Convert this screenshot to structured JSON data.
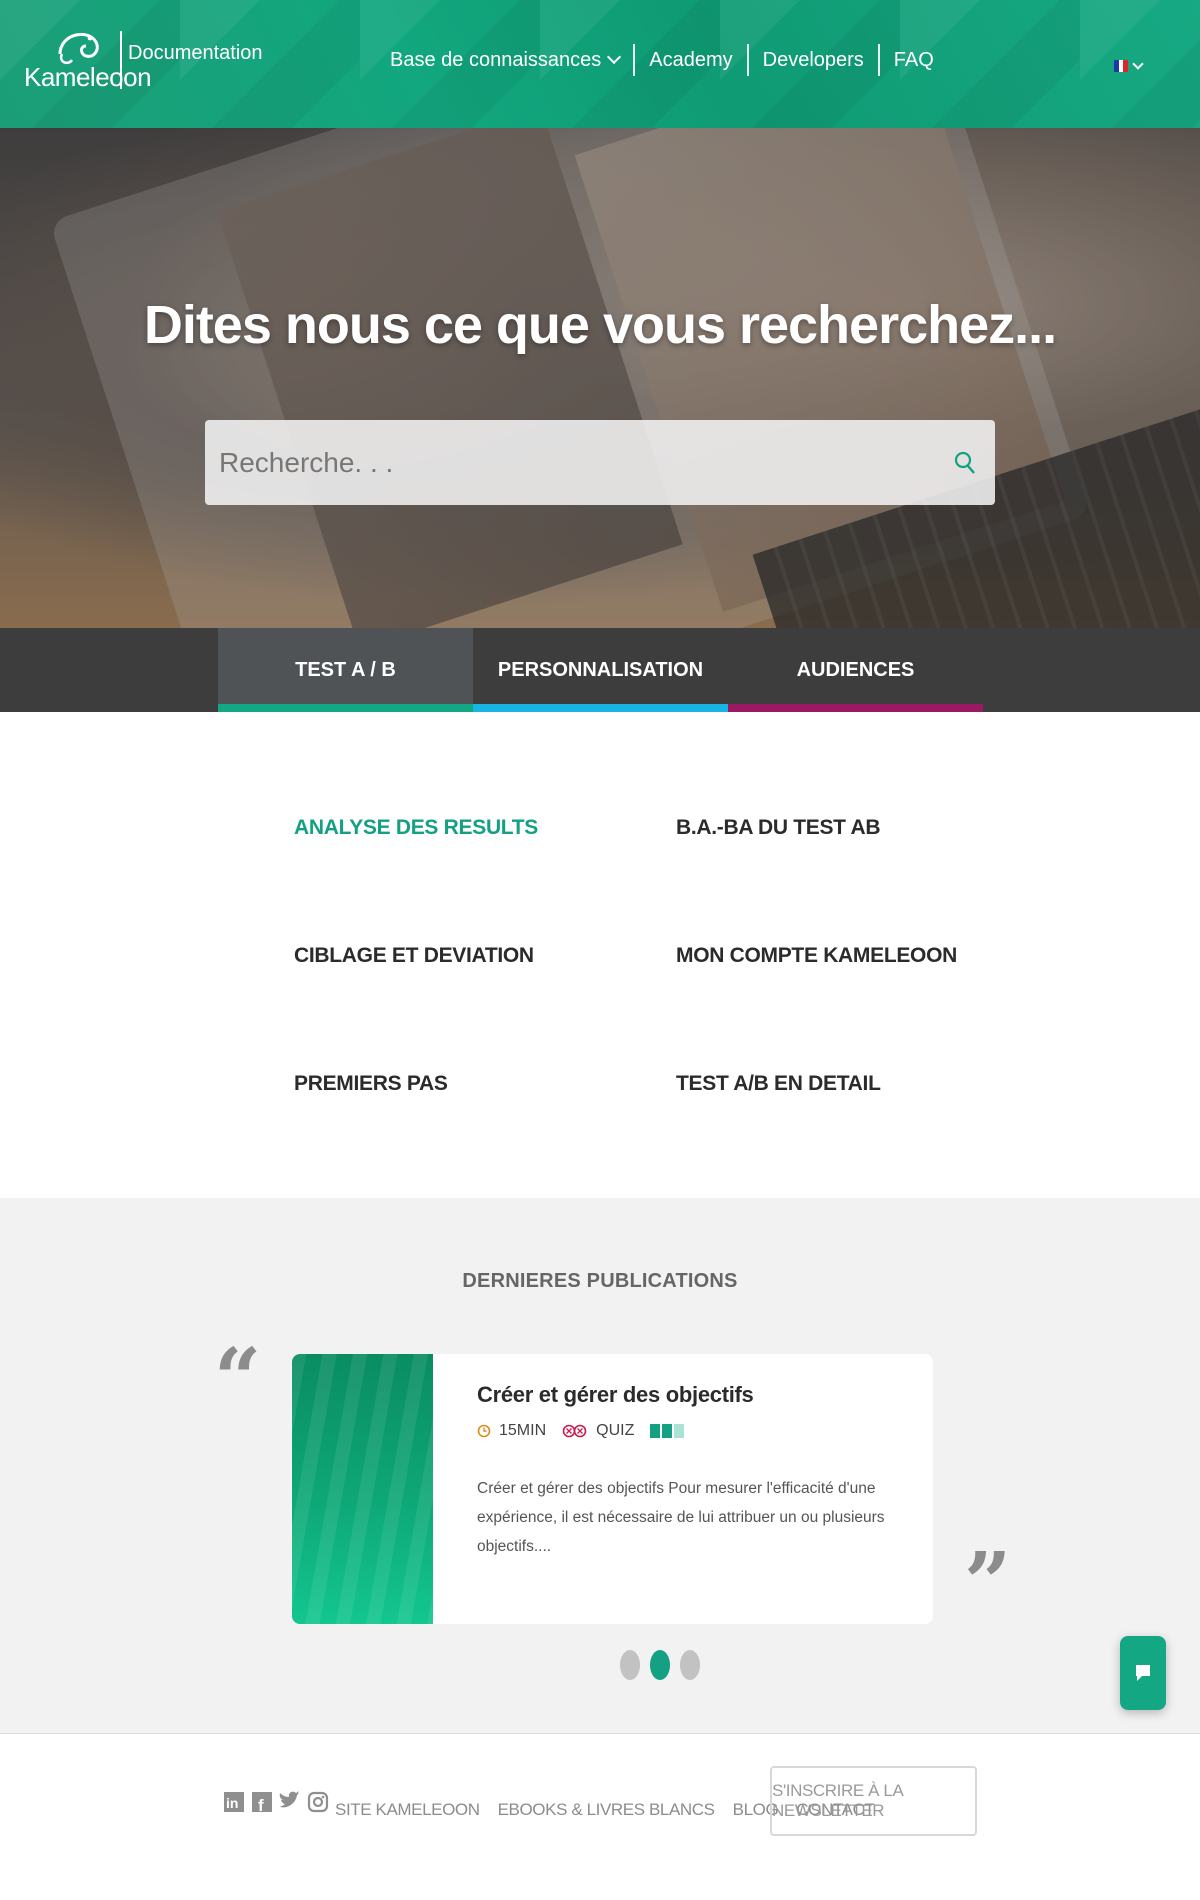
{
  "header": {
    "logo_text": "Kameleoon",
    "section_label": "Documentation",
    "nav": [
      {
        "label": "Base de connaissances"
      },
      {
        "label": "Academy"
      },
      {
        "label": "Developers"
      },
      {
        "label": "FAQ"
      }
    ],
    "language_flag": "fr-flag-icon"
  },
  "hero": {
    "title": "Dites nous ce que vous recherchez...",
    "search_placeholder": "Recherche. . ."
  },
  "tabs": [
    {
      "label": "TEST A / B",
      "underline_color": "#14a785",
      "active": true
    },
    {
      "label": "PERSONNALISATION",
      "underline_color": "#18b5e2",
      "active": false
    },
    {
      "label": "AUDIENCES",
      "underline_color": "#9b1863",
      "active": false
    }
  ],
  "categories": [
    {
      "label": "ANALYSE DES RESULTS",
      "active": true
    },
    {
      "label": "B.A.-BA DU TEST AB",
      "active": false
    },
    {
      "label": "CIBLAGE ET DEVIATION",
      "active": false
    },
    {
      "label": "MON COMPTE KAMELEOON",
      "active": false
    },
    {
      "label": "PREMIERS PAS",
      "active": false
    },
    {
      "label": "TEST A/B EN DETAIL",
      "active": false
    }
  ],
  "publications": {
    "section_title": "DERNIERES PUBLICATIONS",
    "open_quote": "“",
    "close_quote": "”",
    "card": {
      "title": "Créer et gérer des objectifs",
      "duration": "15MIN",
      "type": "QUIZ",
      "description": "Créer et gérer des objectifs Pour mesurer l'efficacité d'une expérience, il est nécessaire de lui attribuer un ou plusieurs objectifs...."
    },
    "carousel_active_index": 1
  },
  "footer": {
    "social_icons": [
      "linkedin-icon",
      "facebook-icon",
      "twitter-icon",
      "instagram-icon"
    ],
    "links": [
      {
        "label": "SITE KAMELEOON"
      },
      {
        "label": "EBOOKS & LIVRES BLANCS"
      },
      {
        "label": "BLOG"
      },
      {
        "label": "CONTACT"
      }
    ],
    "newsletter_label": "S'INSCRIRE À LA NEWSLETTER"
  },
  "colors": {
    "brand_green": "#14a082",
    "header_green": "#12a77e",
    "tab_bar": "#3d3d3d",
    "personalisation_blue": "#18b5e2",
    "audiences_purple": "#9b1863"
  }
}
